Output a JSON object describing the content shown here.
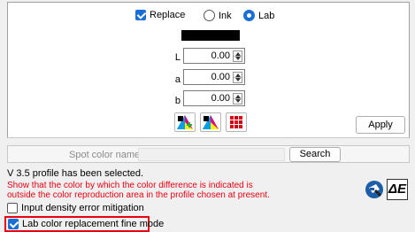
{
  "replace": {
    "label": "Replace",
    "checked": true
  },
  "mode": {
    "options": [
      {
        "label": "Ink",
        "selected": false
      },
      {
        "label": "Lab",
        "selected": true
      }
    ]
  },
  "color_swatch": "#000000",
  "lab_fields": [
    {
      "label": "L",
      "value": "0.00"
    },
    {
      "label": "a",
      "value": "0.00"
    },
    {
      "label": "b",
      "value": "0.00"
    }
  ],
  "tool_icons": [
    "color-palette-add-icon",
    "color-palette-icon",
    "color-grid-icon"
  ],
  "apply_button": "Apply",
  "spot": {
    "label": "Spot color name",
    "search_button": "Search",
    "value": ""
  },
  "profile_status": "V 3.5 profile has been selected.",
  "warning": [
    "Show that the color by which the color difference is indicated is",
    "outside the color reproduction area in the profile chosen at present."
  ],
  "right_icons": [
    "color-picker-icon",
    "delta-e-icon"
  ],
  "delta_e_text": "ΔE",
  "options": [
    {
      "label": "Input density error mitigation",
      "checked": false
    },
    {
      "label": "Lab color replacement fine mode",
      "checked": true
    }
  ],
  "accent": "#1a6fd6",
  "warning_color": "#e60012"
}
